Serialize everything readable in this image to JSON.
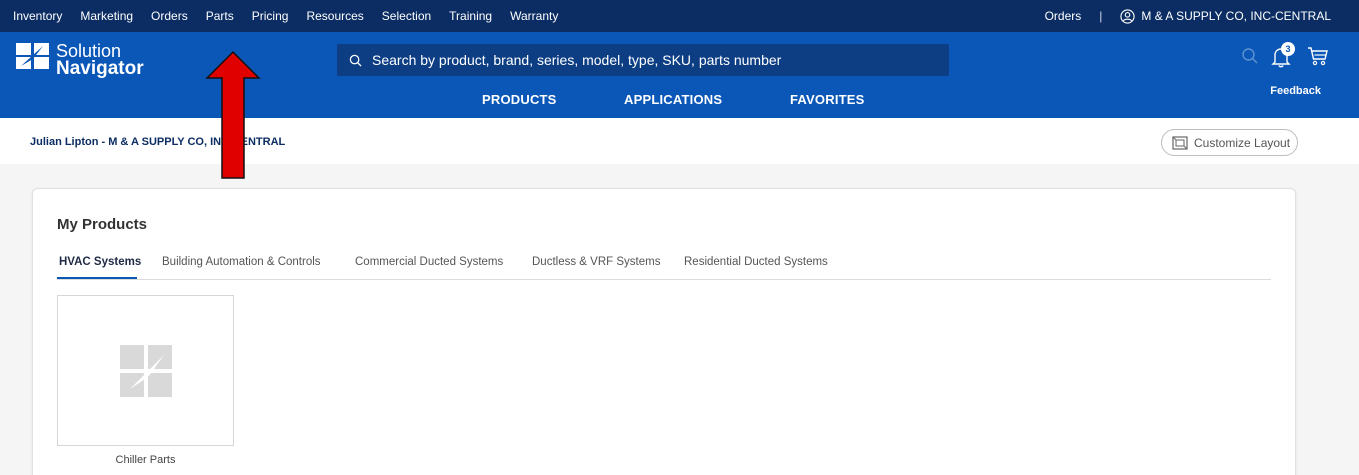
{
  "top_menu": {
    "items": [
      "Inventory",
      "Marketing",
      "Orders",
      "Parts",
      "Pricing",
      "Resources",
      "Selection",
      "Training",
      "Warranty"
    ],
    "orders": "Orders",
    "separator": "|",
    "account": "M & A SUPPLY CO, INC-CENTRAL"
  },
  "logo": {
    "line1": "Solution",
    "line2": "Navigator"
  },
  "search": {
    "placeholder": "Search by product, brand, series, model, type, SKU, parts number"
  },
  "nav": {
    "products": "PRODUCTS",
    "applications": "APPLICATIONS",
    "favorites": "FAVORITES"
  },
  "header_icons": {
    "notification_count": "3",
    "feedback": "Feedback"
  },
  "subbar": {
    "user": "Julian Lipton - M & A SUPPLY CO, INC-CENTRAL",
    "customize": "Customize Layout"
  },
  "card": {
    "title": "My Products",
    "tabs": [
      "HVAC Systems",
      "Building Automation & Controls",
      "Commercial Ducted Systems",
      "Ductless & VRF Systems",
      "Residential Ducted Systems"
    ],
    "tile_label": "Chiller Parts"
  },
  "colors": {
    "topbar": "#0b2d63",
    "header": "#0a57b8",
    "arrow": "#e00000"
  },
  "icons": [
    "search-icon",
    "user-circle-icon",
    "bell-icon",
    "cart-icon",
    "layout-icon",
    "product-placeholder-icon",
    "red-arrow"
  ]
}
